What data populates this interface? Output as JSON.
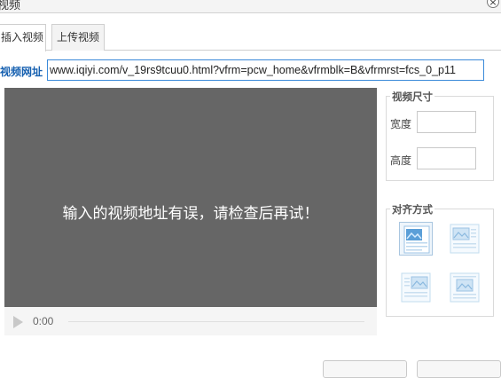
{
  "dialog": {
    "title": "视频",
    "close_glyph": "×"
  },
  "tabs": [
    {
      "label": "插入视频",
      "active": true
    },
    {
      "label": "上传视频",
      "active": false
    }
  ],
  "url_field": {
    "label": "视频网址",
    "value": "www.iqiyi.com/v_19rs9tcuu0.html?vfrm=pcw_home&vfrmblk=B&vfrmrst=fcs_0_p11"
  },
  "preview": {
    "message": "输入的视频地址有误，请检查后再试！",
    "time": "0:00"
  },
  "size_panel": {
    "legend": "视频尺寸",
    "width_label": "宽度",
    "height_label": "高度",
    "width_value": "",
    "height_value": ""
  },
  "align_panel": {
    "legend": "对齐方式",
    "options": [
      "none",
      "left",
      "right",
      "center"
    ],
    "selected": "none"
  },
  "colors": {
    "accent": "#3b8ad9",
    "label_blue": "#1660b0",
    "preview_bg": "#666666"
  }
}
